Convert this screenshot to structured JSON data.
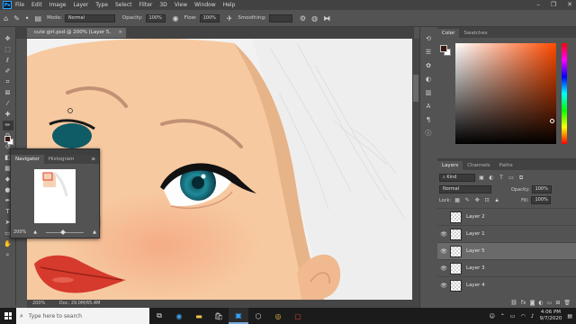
{
  "menubar": {
    "logo": "Ps",
    "items": [
      "File",
      "Edit",
      "Image",
      "Layer",
      "Type",
      "Select",
      "Filter",
      "3D",
      "View",
      "Window",
      "Help"
    ],
    "window_controls": [
      "–",
      "❐",
      "✕"
    ]
  },
  "options": {
    "mode_label": "Mode:",
    "mode_value": "Normal",
    "opacity_label": "Opacity:",
    "opacity_value": "100%",
    "flow_label": "Flow:",
    "flow_value": "100%",
    "smoothing_label": "Smoothing:",
    "smoothing_value": ""
  },
  "document": {
    "tab_title": "cute girl.psd @ 200% (Layer 5, RGB/8) *",
    "close": "×",
    "zoom": "200%",
    "doc_info": "Doc: 29.0M/65.4M"
  },
  "navigator": {
    "tabs": [
      "Navigator",
      "Histogram"
    ],
    "zoom": "200%"
  },
  "color_panel": {
    "tabs": [
      "Color",
      "Swatches"
    ],
    "foreground": "#3c1810",
    "background": "#ffffff"
  },
  "layers_panel": {
    "tabs": [
      "Layers",
      "Channels",
      "Paths"
    ],
    "filter_label": "Kind",
    "blend_mode": "Normal",
    "opacity_label": "Opacity:",
    "opacity_value": "100%",
    "lock_label": "Lock:",
    "fill_label": "Fill:",
    "fill_value": "100%",
    "layers": [
      {
        "name": "Layer 2",
        "visible": false,
        "selected": false
      },
      {
        "name": "Layer 1",
        "visible": true,
        "selected": false
      },
      {
        "name": "Layer 5",
        "visible": true,
        "selected": true
      },
      {
        "name": "Layer 3",
        "visible": true,
        "selected": false
      },
      {
        "name": "Layer 4",
        "visible": true,
        "selected": false
      }
    ]
  },
  "taskbar": {
    "search_placeholder": "Type here to search",
    "time": "4:06 PM",
    "date": "9/7/2020"
  },
  "colors": {
    "skin": "#f7c9a0",
    "iris": "#1f7f8e",
    "lips": "#d63a2c"
  }
}
